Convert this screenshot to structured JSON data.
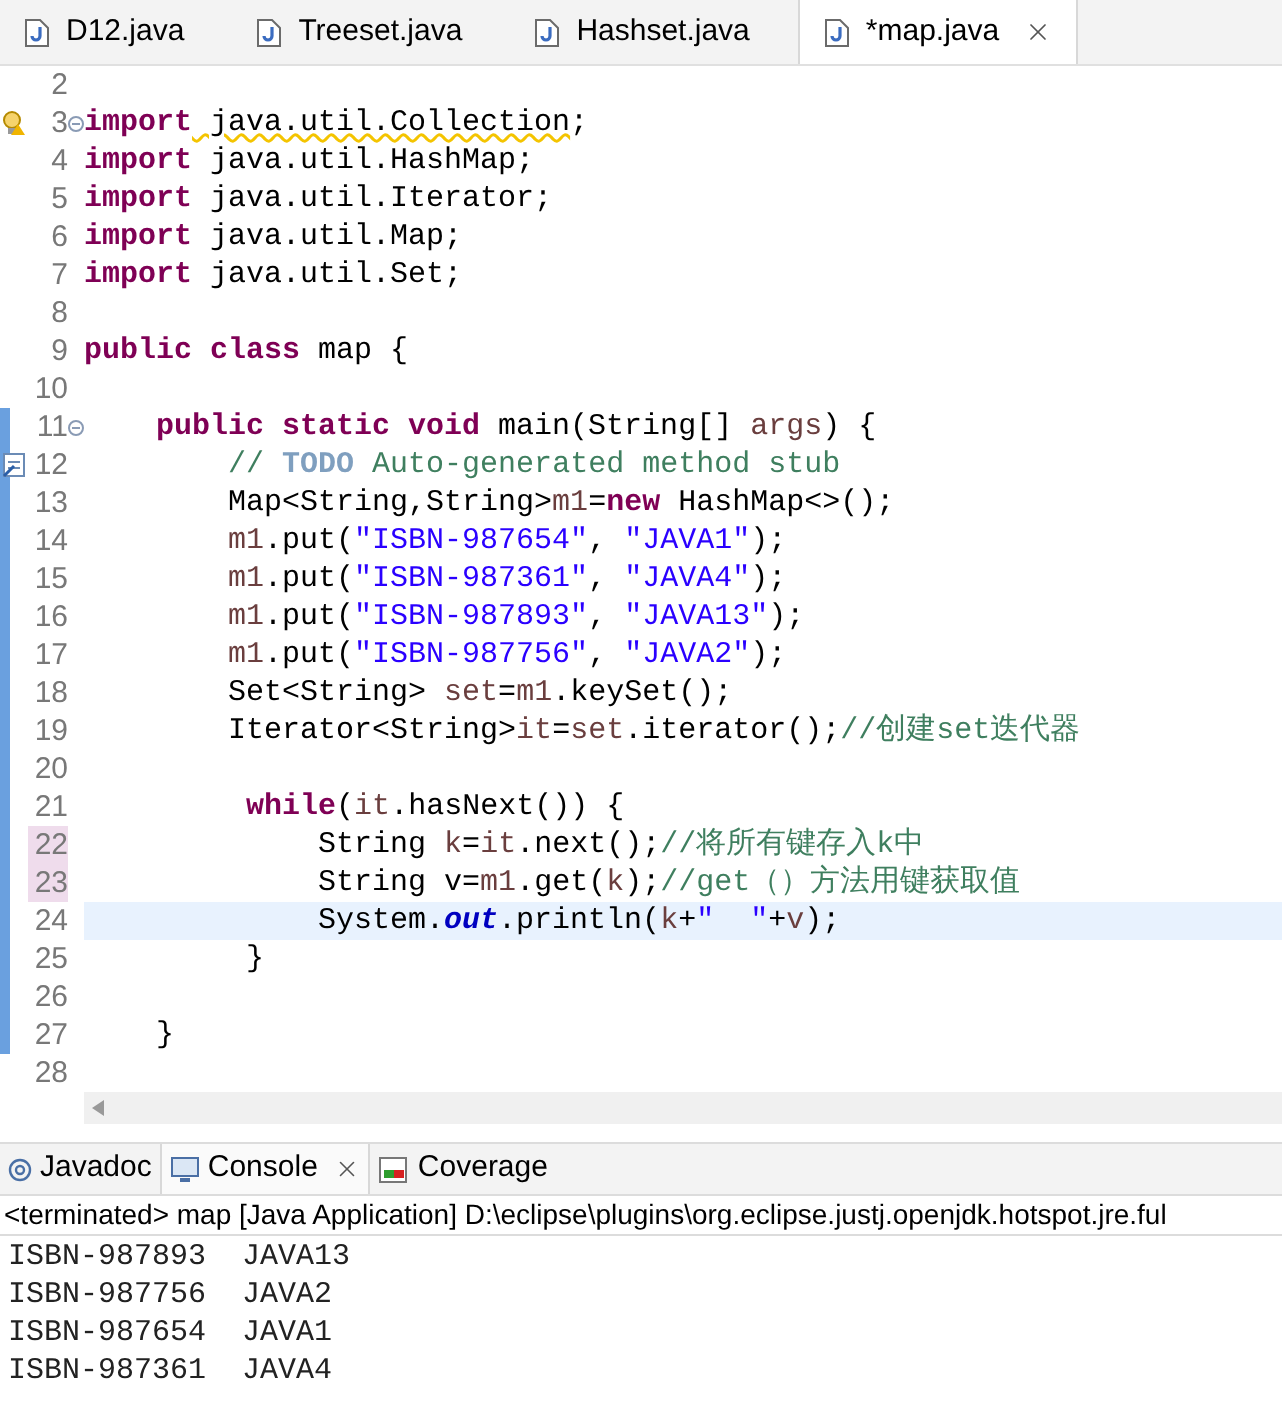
{
  "editor_tabs": [
    {
      "label": "D12.java",
      "selected": false
    },
    {
      "label": "Treeset.java",
      "selected": false
    },
    {
      "label": "Hashset.java",
      "selected": false
    },
    {
      "label": "*map.java",
      "selected": true
    }
  ],
  "code": [
    {
      "number": "2"
    },
    {
      "number": "3",
      "warning": true,
      "fold": true,
      "tokens": [
        {
          "kind": "keyword",
          "text": "import"
        },
        {
          "kind": "warn",
          "text": " java.util.Collection"
        },
        {
          "kind": "plain",
          "text": ";"
        }
      ]
    },
    {
      "number": "4",
      "tokens": [
        {
          "kind": "keyword",
          "text": "import"
        },
        {
          "kind": "plain",
          "text": " java.util.HashMap;"
        }
      ]
    },
    {
      "number": "5",
      "tokens": [
        {
          "kind": "keyword",
          "text": "import"
        },
        {
          "kind": "plain",
          "text": " java.util.Iterator;"
        }
      ]
    },
    {
      "number": "6",
      "tokens": [
        {
          "kind": "keyword",
          "text": "import"
        },
        {
          "kind": "plain",
          "text": " java.util.Map;"
        }
      ]
    },
    {
      "number": "7",
      "tokens": [
        {
          "kind": "keyword",
          "text": "import"
        },
        {
          "kind": "plain",
          "text": " java.util.Set;"
        }
      ]
    },
    {
      "number": "8"
    },
    {
      "number": "9",
      "tokens": [
        {
          "kind": "keyword",
          "text": "public class"
        },
        {
          "kind": "plain",
          "text": " map {"
        }
      ]
    },
    {
      "number": "10"
    },
    {
      "number": "11",
      "fold": true,
      "edited": true,
      "tokens": [
        {
          "kind": "keyword",
          "text": "    public static void"
        },
        {
          "kind": "plain",
          "text": " main(String[] "
        },
        {
          "kind": "variable",
          "text": "args"
        },
        {
          "kind": "plain",
          "text": ") {"
        }
      ]
    },
    {
      "number": "12",
      "task": true,
      "edited": true,
      "tokens": [
        {
          "kind": "comment",
          "text": "        // "
        },
        {
          "kind": "todo",
          "text": "TODO"
        },
        {
          "kind": "comment",
          "text": " Auto-generated method stub"
        }
      ]
    },
    {
      "number": "13",
      "edited": true,
      "tokens": [
        {
          "kind": "plain",
          "text": "        Map<String,String>"
        },
        {
          "kind": "variable",
          "text": "m1"
        },
        {
          "kind": "plain",
          "text": "="
        },
        {
          "kind": "keyword",
          "text": "new"
        },
        {
          "kind": "plain",
          "text": " HashMap<>();"
        }
      ]
    },
    {
      "number": "14",
      "edited": true,
      "tokens": [
        {
          "kind": "variable",
          "text": "        m1"
        },
        {
          "kind": "plain",
          "text": ".put("
        },
        {
          "kind": "string",
          "text": "\"ISBN-987654\""
        },
        {
          "kind": "plain",
          "text": ", "
        },
        {
          "kind": "string",
          "text": "\"JAVA1\""
        },
        {
          "kind": "plain",
          "text": ");"
        }
      ]
    },
    {
      "number": "15",
      "edited": true,
      "tokens": [
        {
          "kind": "variable",
          "text": "        m1"
        },
        {
          "kind": "plain",
          "text": ".put("
        },
        {
          "kind": "string",
          "text": "\"ISBN-987361\""
        },
        {
          "kind": "plain",
          "text": ", "
        },
        {
          "kind": "string",
          "text": "\"JAVA4\""
        },
        {
          "kind": "plain",
          "text": ");"
        }
      ]
    },
    {
      "number": "16",
      "edited": true,
      "tokens": [
        {
          "kind": "variable",
          "text": "        m1"
        },
        {
          "kind": "plain",
          "text": ".put("
        },
        {
          "kind": "string",
          "text": "\"ISBN-987893\""
        },
        {
          "kind": "plain",
          "text": ", "
        },
        {
          "kind": "string",
          "text": "\"JAVA13\""
        },
        {
          "kind": "plain",
          "text": ");"
        }
      ]
    },
    {
      "number": "17",
      "edited": true,
      "tokens": [
        {
          "kind": "variable",
          "text": "        m1"
        },
        {
          "kind": "plain",
          "text": ".put("
        },
        {
          "kind": "string",
          "text": "\"ISBN-987756\""
        },
        {
          "kind": "plain",
          "text": ", "
        },
        {
          "kind": "string",
          "text": "\"JAVA2\""
        },
        {
          "kind": "plain",
          "text": ");"
        }
      ]
    },
    {
      "number": "18",
      "edited": true,
      "tokens": [
        {
          "kind": "plain",
          "text": "        Set<String> "
        },
        {
          "kind": "variable",
          "text": "set"
        },
        {
          "kind": "plain",
          "text": "="
        },
        {
          "kind": "variable",
          "text": "m1"
        },
        {
          "kind": "plain",
          "text": ".keySet();"
        }
      ]
    },
    {
      "number": "19",
      "edited": true,
      "tokens": [
        {
          "kind": "plain",
          "text": "        Iterator<String>"
        },
        {
          "kind": "variable",
          "text": "it"
        },
        {
          "kind": "plain",
          "text": "="
        },
        {
          "kind": "variable",
          "text": "set"
        },
        {
          "kind": "plain",
          "text": ".iterator();"
        },
        {
          "kind": "comment",
          "text": "//创建set迭代器"
        }
      ]
    },
    {
      "number": "20",
      "edited": true
    },
    {
      "number": "21",
      "edited": true,
      "tokens": [
        {
          "kind": "keyword",
          "text": "         while"
        },
        {
          "kind": "plain",
          "text": "("
        },
        {
          "kind": "variable",
          "text": "it"
        },
        {
          "kind": "plain",
          "text": ".hasNext()) {"
        }
      ]
    },
    {
      "number": "22",
      "edited": true,
      "changed": true,
      "tokens": [
        {
          "kind": "plain",
          "text": "             String "
        },
        {
          "kind": "variable",
          "text": "k"
        },
        {
          "kind": "plain",
          "text": "="
        },
        {
          "kind": "variable",
          "text": "it"
        },
        {
          "kind": "plain",
          "text": ".next();"
        },
        {
          "kind": "comment",
          "text": "//将所有键存入k中"
        }
      ]
    },
    {
      "number": "23",
      "edited": true,
      "changed": true,
      "tokens": [
        {
          "kind": "plain",
          "text": "             String v="
        },
        {
          "kind": "variable",
          "text": "m1"
        },
        {
          "kind": "plain",
          "text": ".get("
        },
        {
          "kind": "variable",
          "text": "k"
        },
        {
          "kind": "plain",
          "text": ");"
        },
        {
          "kind": "comment",
          "text": "//get（）方法用键获取值"
        }
      ]
    },
    {
      "number": "24",
      "edited": true,
      "current": true,
      "tokens": [
        {
          "kind": "plain",
          "text": "             System."
        },
        {
          "kind": "static",
          "text": "out"
        },
        {
          "kind": "plain",
          "text": ".println("
        },
        {
          "kind": "variable",
          "text": "k"
        },
        {
          "kind": "plain",
          "text": "+"
        },
        {
          "kind": "string",
          "text": "\"  \""
        },
        {
          "kind": "plain",
          "text": "+"
        },
        {
          "kind": "variable",
          "text": "v"
        },
        {
          "kind": "plain",
          "text": ");"
        }
      ]
    },
    {
      "number": "25",
      "edited": true,
      "tokens": [
        {
          "kind": "plain",
          "text": "         }"
        }
      ]
    },
    {
      "number": "26",
      "edited": true
    },
    {
      "number": "27",
      "edited": true,
      "tokens": [
        {
          "kind": "plain",
          "text": "    }"
        }
      ]
    },
    {
      "number": "28"
    }
  ],
  "view_tabs": [
    {
      "label": "Javadoc",
      "kind": "javadoc",
      "selected": false
    },
    {
      "label": "Console",
      "kind": "console",
      "selected": true
    },
    {
      "label": "Coverage",
      "kind": "coverage",
      "selected": false
    }
  ],
  "console": {
    "header": "<terminated> map [Java Application] D:\\eclipse\\plugins\\org.eclipse.justj.openjdk.hotspot.jre.ful",
    "output": [
      "ISBN-987893  JAVA13",
      "ISBN-987756  JAVA2",
      "ISBN-987654  JAVA1",
      "ISBN-987361  JAVA4"
    ]
  }
}
